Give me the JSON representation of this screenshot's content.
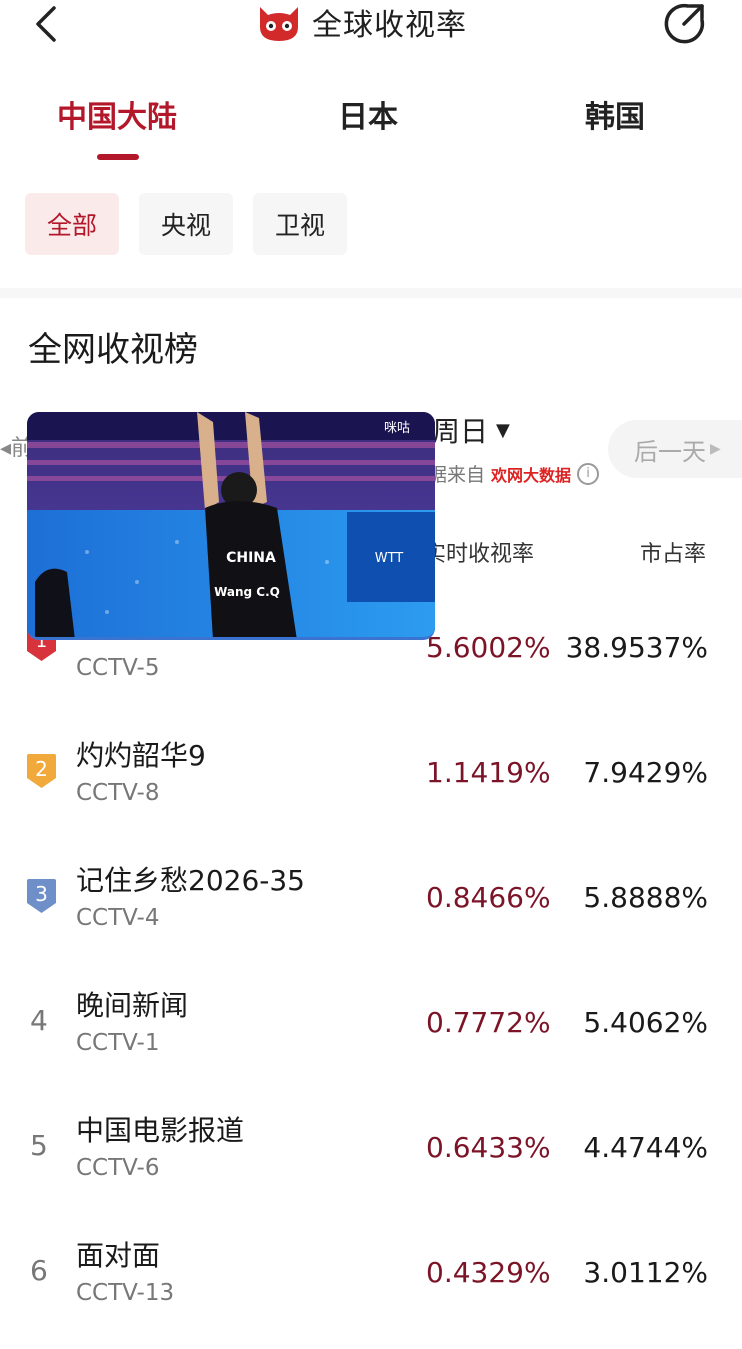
{
  "header": {
    "title": "全球收视率",
    "back_icon": "chevron-left-icon",
    "share_icon": "share-icon"
  },
  "region_tabs": [
    {
      "label": "中国大陆",
      "active": true
    },
    {
      "label": "日本",
      "active": false
    },
    {
      "label": "韩国",
      "active": false
    }
  ],
  "filter_chips": [
    {
      "label": "全部",
      "active": true
    },
    {
      "label": "央视",
      "active": false
    },
    {
      "label": "卫视",
      "active": false
    }
  ],
  "section_title": "全网收视榜",
  "date_bar": {
    "prev_label": "前",
    "date_label": "周日",
    "next_label": "后一天",
    "source_prefix": "据来自",
    "source_brand": "欢网大数据"
  },
  "columns": {
    "rating": "实时收视率",
    "share": "市占率"
  },
  "rows": [
    {
      "rank": "1",
      "name": "",
      "channel": "CCTV-5",
      "rating": "5.6002%",
      "share": "38.9537%"
    },
    {
      "rank": "2",
      "name": "灼灼韶华9",
      "channel": "CCTV-8",
      "rating": "1.1419%",
      "share": "7.9429%"
    },
    {
      "rank": "3",
      "name": "记住乡愁2026-35",
      "channel": "CCTV-4",
      "rating": "0.8466%",
      "share": "5.8888%"
    },
    {
      "rank": "4",
      "name": "晚间新闻",
      "channel": "CCTV-1",
      "rating": "0.7772%",
      "share": "5.4062%"
    },
    {
      "rank": "5",
      "name": "中国电影报道",
      "channel": "CCTV-6",
      "rating": "0.6433%",
      "share": "4.4744%"
    },
    {
      "rank": "6",
      "name": "面对面",
      "channel": "CCTV-13",
      "rating": "0.4329%",
      "share": "3.0112%"
    }
  ],
  "video_overlay": {
    "jersey_text": "CHINA",
    "player_text": "Wang C.Q",
    "channel_logo": "咪咕"
  },
  "colors": {
    "accent": "#b3182a",
    "rating": "#7c1428",
    "gold": "#f2a93b",
    "silver": "#6f8fc9"
  }
}
